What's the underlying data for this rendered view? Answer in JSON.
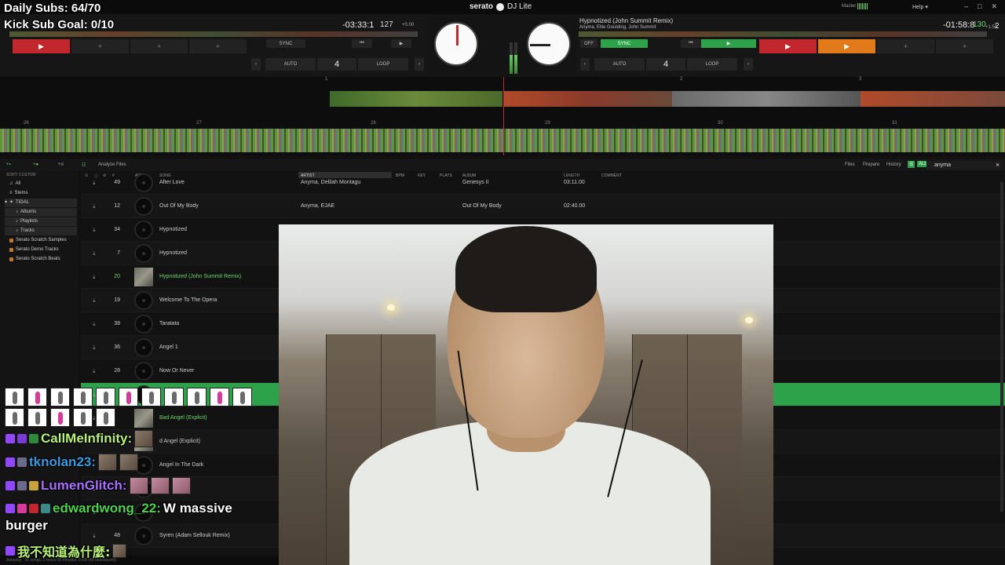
{
  "overlay": {
    "daily_subs": "Daily Subs: 64/70",
    "kick_goal": "Kick Sub Goal: 0/10"
  },
  "app": {
    "brand": "serato",
    "product": "DJ Lite",
    "master": "Master",
    "help": "Help ▾",
    "window_icons": [
      "–",
      "□",
      "✕"
    ]
  },
  "deck_left": {
    "time": "-03:33:1",
    "bpm": "127",
    "pitch": "+0.00",
    "number": "1",
    "sync": "SYNC",
    "auto": "AUTO",
    "loop": "LOOP",
    "beats": "4",
    "prev": "‹",
    "next": "›"
  },
  "deck_right": {
    "title": "Hypnotized (John Summit Remix)",
    "artist": "Anyma, Ellie Goulding, John Summit",
    "time": "-01:58:8",
    "bpm": "130",
    "pitch": "+1.59",
    "number": "2",
    "off": "OFF",
    "sync": "SYNC",
    "auto": "AUTO",
    "loop": "LOOP",
    "beats": "4",
    "prev": "‹",
    "next": "›"
  },
  "waveform": {
    "markers_top": [
      "1",
      "2",
      "3"
    ],
    "markers_main": [
      "26",
      "27",
      "28",
      "29",
      "30",
      "31"
    ]
  },
  "library": {
    "tabs": [
      "Files",
      "Prepare",
      "History"
    ],
    "analyze": "Analyze Files",
    "search_value": "anyma",
    "sort_label": "SORT: CUSTOM",
    "columns": {
      "num": "#",
      "art": "ART",
      "song": "SONG",
      "artist": "ARTIST",
      "bpm": "BPM",
      "key": "KEY",
      "plays": "PLAYS",
      "album": "ALBUM",
      "length": "LENGTH",
      "comment": "COMMENT"
    },
    "status": "50 songs, 2 hours 59 minutes, 0 KB (48 unanalyzed)",
    "autoplay": "Autoplay"
  },
  "sidebar": {
    "items": [
      {
        "label": "All"
      },
      {
        "label": "Stems"
      },
      {
        "label": "TIDAL"
      },
      {
        "label": "Albums"
      },
      {
        "label": "Playlists"
      },
      {
        "label": "Tracks"
      },
      {
        "label": "Serato Scratch Samples"
      },
      {
        "label": "Serato Demo Tracks"
      },
      {
        "label": "Serato Scratch Beats"
      }
    ]
  },
  "tracks": [
    {
      "num": "49",
      "song": "After Love",
      "artist": "Anyma, Delilah Montagu",
      "album": "Genesys II",
      "length": "03:11.00"
    },
    {
      "num": "12",
      "song": "Out Of My Body",
      "artist": "Anyma, EJAE",
      "album": "Out Of My Body",
      "length": "02:40.00"
    },
    {
      "num": "34",
      "song": "Hypnotized",
      "artist": "",
      "album": "",
      "length": ""
    },
    {
      "num": "7",
      "song": "Hypnotized",
      "artist": "",
      "album": "",
      "length": ""
    },
    {
      "num": "20",
      "song": "Hypnotized (John Summit Remix)",
      "artist": "",
      "album": "",
      "length": ""
    },
    {
      "num": "19",
      "song": "Welcome To The Opera",
      "artist": "",
      "album": "",
      "length": ""
    },
    {
      "num": "38",
      "song": "Taratata",
      "artist": "",
      "album": "",
      "length": ""
    },
    {
      "num": "36",
      "song": "Angel 1",
      "artist": "",
      "album": "",
      "length": ""
    },
    {
      "num": "28",
      "song": "Now Or Never",
      "artist": "",
      "album": "",
      "length": ""
    },
    {
      "num": "",
      "song": "",
      "artist": "",
      "album": "",
      "length": ""
    },
    {
      "num": "",
      "song": "Bad Angel (Explicit)",
      "artist": "",
      "album": "",
      "length": ""
    },
    {
      "num": "",
      "song": "d Angel (Explicit)",
      "artist": "",
      "album": "",
      "length": ""
    },
    {
      "num": "",
      "song": "Angel In The Dark",
      "artist": "",
      "album": "",
      "length": ""
    },
    {
      "num": "",
      "song": "",
      "artist": "",
      "album": "",
      "length": ""
    },
    {
      "num": "",
      "song": "",
      "artist": "",
      "album": "",
      "length": ""
    },
    {
      "num": "48",
      "song": "Syren (Adam Sellouk Remix)",
      "artist": "",
      "album": "",
      "length": ""
    }
  ],
  "chat": [
    {
      "user": "CallMeInfinity:",
      "message": "",
      "color": "#b7f07a"
    },
    {
      "user": "tknolan23:",
      "message": "",
      "color": "#3a9be0"
    },
    {
      "user": "LumenGlitch:",
      "message": "",
      "color": "#a970ff"
    },
    {
      "user": "edwardwong_22:",
      "message": "W massive",
      "color": "#4fd24f"
    },
    {
      "user": "",
      "message": "burger",
      "color": "#ffffff"
    },
    {
      "user": "我不知道為什麼:",
      "message": "",
      "color": "#b7f07a"
    }
  ],
  "colors": {
    "accent_green": "#2da24a",
    "accent_red": "#c1272d",
    "accent_orange": "#e07a1a"
  }
}
